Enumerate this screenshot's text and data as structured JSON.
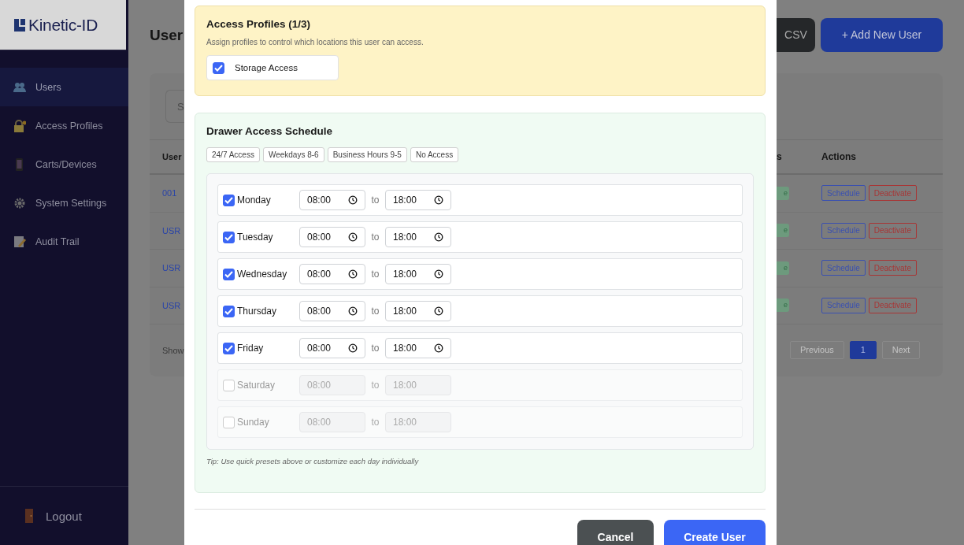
{
  "sidebar": {
    "logo": "Kinetic-ID",
    "items": [
      {
        "label": "Users",
        "selected": true
      },
      {
        "label": "Access Profiles",
        "selected": false
      },
      {
        "label": "Carts/Devices",
        "selected": false
      },
      {
        "label": "System Settings",
        "selected": false
      },
      {
        "label": "Audit Trail",
        "selected": false
      }
    ],
    "logout": "Logout"
  },
  "page": {
    "title": "User",
    "buttons": [
      {
        "label": "CSV",
        "kind": "dark"
      },
      {
        "label": "+ Add New User",
        "kind": "primary"
      }
    ],
    "search": {
      "placeholder": "S"
    },
    "table": {
      "columns": [
        "User",
        "s",
        "Actions"
      ],
      "rows": [
        {
          "column_1": "001",
          "status": "e",
          "actions": [
            "Schedule",
            "Deactivate"
          ]
        },
        {
          "column_1": "USR",
          "status": "e",
          "actions": [
            "Schedule",
            "Deactivate"
          ]
        },
        {
          "column_1": "USR",
          "status": "e",
          "actions": [
            "Schedule",
            "Deactivate"
          ]
        },
        {
          "column_1": "USR",
          "status": "e",
          "actions": [
            "Schedule",
            "Deactivate"
          ]
        }
      ]
    },
    "footer": {
      "text": "Show",
      "pagination": [
        {
          "label": "Previous",
          "selected": false,
          "disabled": true
        },
        {
          "label": "1",
          "selected": true,
          "disabled": false
        },
        {
          "label": "Next",
          "selected": false,
          "disabled": true
        }
      ]
    }
  },
  "modal": {
    "profiles": {
      "title": "Access Profiles (1/3)",
      "description": "Assign profiles to control which locations this user can access.",
      "options": [
        {
          "label": "Storage Access",
          "checked": true
        }
      ]
    },
    "schedule": {
      "title": "Drawer Access Schedule",
      "presets": [
        "24/7 Access",
        "Weekdays 8-6",
        "Business Hours 9-5",
        "No Access"
      ],
      "days": [
        {
          "day": "Monday",
          "checked": true,
          "from": "08:00",
          "separator": "to",
          "to": "18:00"
        },
        {
          "day": "Tuesday",
          "checked": true,
          "from": "08:00",
          "separator": "to",
          "to": "18:00"
        },
        {
          "day": "Wednesday",
          "checked": true,
          "from": "08:00",
          "separator": "to",
          "to": "18:00"
        },
        {
          "day": "Thursday",
          "checked": true,
          "from": "08:00",
          "separator": "to",
          "to": "18:00"
        },
        {
          "day": "Friday",
          "checked": true,
          "from": "08:00",
          "separator": "to",
          "to": "18:00"
        },
        {
          "day": "Saturday",
          "checked": false,
          "from": "08:00",
          "separator": "to",
          "to": "18:00"
        },
        {
          "day": "Sunday",
          "checked": false,
          "from": "08:00",
          "separator": "to",
          "to": "18:00"
        }
      ],
      "tip": "Tip: Use quick presets above or customize each day individually"
    },
    "buttons": [
      {
        "label": "Cancel",
        "kind": "secondary"
      },
      {
        "label": "Create User",
        "kind": "primary"
      }
    ]
  }
}
